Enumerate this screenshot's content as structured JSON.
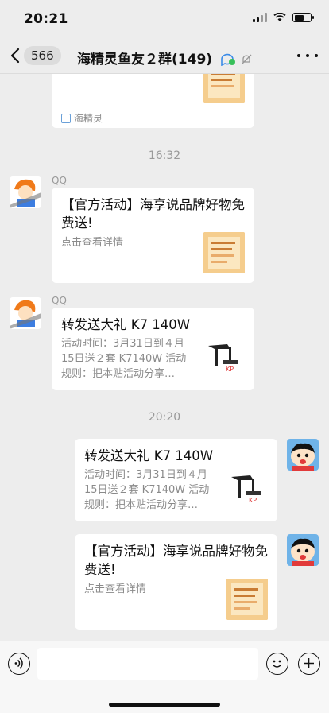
{
  "status_bar": {
    "time": "20:21"
  },
  "nav": {
    "back_count": "566",
    "title": "海精灵鱼友２群(149)"
  },
  "messages": {
    "top_card": {
      "source": "海精灵"
    },
    "ts1": "16:32",
    "m1": {
      "sender": "QQ",
      "title": "【官方活动】海享说品牌好物免费送!",
      "desc": "点击查看详情"
    },
    "m2": {
      "sender": "QQ",
      "title": "转发送大礼 K7 140W",
      "desc": "活动时间：3月31日到４月15日送２套 K7140W 活动规则：把本贴活动分享…"
    },
    "ts2": "20:20",
    "m3": {
      "title": "转发送大礼 K7 140W",
      "desc": "活动时间：3月31日到４月15日送２套 K7140W 活动规则：把本贴活动分享…"
    },
    "m4": {
      "title": "【官方活动】海享说品牌好物免费送!",
      "desc": "点击查看详情"
    }
  },
  "colors": {
    "background": "#ededed",
    "card": "#ffffff",
    "muted": "#999999"
  }
}
